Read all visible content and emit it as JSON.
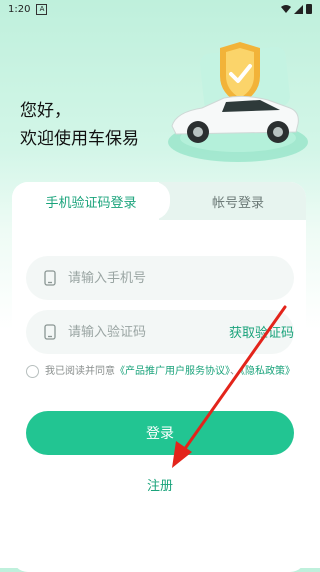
{
  "status_bar": {
    "time": "1:20",
    "notification_glyph": "A"
  },
  "greeting": {
    "line1": "您好，",
    "line2": "欢迎使用车保易"
  },
  "tabs": {
    "active_label": "手机验证码登录",
    "inactive_label": "帐号登录"
  },
  "phone_field": {
    "placeholder": "请输入手机号",
    "icon": "phone-icon"
  },
  "code_field": {
    "placeholder": "请输入验证码",
    "icon": "phone-icon"
  },
  "get_code_label": "获取验证码",
  "agreement": {
    "prefix": "我已阅读并同意",
    "link1": "《产品推广用户服务协议》",
    "separator": "、",
    "link2": "《隐私政策》"
  },
  "login_label": "登录",
  "register_label": "注册",
  "colors": {
    "accent": "#22c592",
    "accent_text": "#1aa37b",
    "annotation": "#e3241b"
  }
}
